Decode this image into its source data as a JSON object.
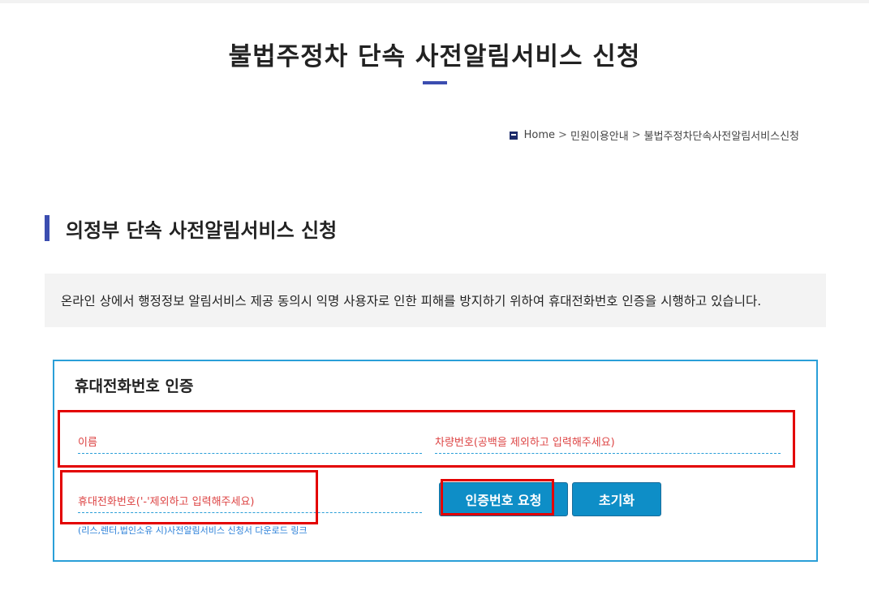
{
  "page": {
    "title": "불법주정차 단속 사전알림서비스 신청"
  },
  "breadcrumb": {
    "home": "Home",
    "level1": "민원이용안내",
    "level2": "불법주정차단속사전알림서비스신청",
    "separator": ">"
  },
  "section": {
    "heading": "의정부 단속 사전알림서비스 신청"
  },
  "notice": {
    "text": "온라인 상에서 행정정보 알림서비스 제공 동의시 익명 사용자로 인한 피해를 방지하기 위하여 휴대전화번호 인증을 시행하고 있습니다."
  },
  "verify": {
    "title": "휴대전화번호 인증",
    "name_placeholder": "이름",
    "car_placeholder": "차량번호(공백을 제외하고 입력해주세요)",
    "phone_placeholder": "휴대전화번호('-'제외하고 입력해주세요)",
    "note": "(리스,렌터,법인소유 시)사전알림서비스 신청서 다운로드 링크",
    "request_button": "인증번호 요청",
    "reset_button": "초기화"
  },
  "colors": {
    "accent": "#3b4db0",
    "button": "#0e8ec7",
    "border": "#2a9fd8",
    "highlight": "#e30000"
  }
}
